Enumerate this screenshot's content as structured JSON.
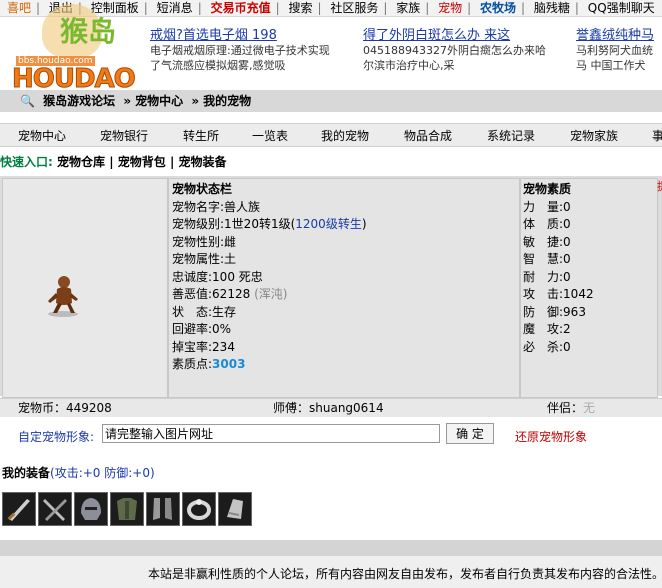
{
  "topnav": [
    "喜吧",
    "退出",
    "控制面板",
    "短消息",
    "交易币充值",
    "搜索",
    "社区服务",
    "家族",
    "宠物",
    "农牧场",
    "脑残糖",
    "QQ强制聊天"
  ],
  "logo": {
    "cn": "猴岛",
    "url": "bbs.houdao.com",
    "brand": "HOUDAO"
  },
  "ads": [
    {
      "title": "戒烟?首选电子烟 198",
      "desc1": "电子烟戒烟原理:通过微电子技术实现",
      "desc2": "了气流感应模拟烟雾,感觉吸"
    },
    {
      "title": "得了外阴白斑怎么办 来这",
      "desc1": "045188943327外阴白癍怎么办来哈",
      "desc2": "尔滨市治疗中心,采"
    },
    {
      "title": "誉鑫绒纯种马",
      "desc1": "马利努阿犬血统",
      "desc2": "马 中国工作犬"
    }
  ],
  "breadcrumb": [
    "猴岛游戏论坛",
    "宠物中心",
    "我的宠物"
  ],
  "menu": [
    "宠物中心",
    "宠物银行",
    "转生所",
    "一览表",
    "我的宠物",
    "物品合成",
    "系统记录",
    "宠物家族",
    "事"
  ],
  "quick": {
    "label": "快速入口:",
    "links": [
      "宠物仓库",
      "宠物背包",
      "宠物装备"
    ]
  },
  "status": {
    "title": "宠物状态栏",
    "name_label": "宠物名字:",
    "name": "兽人族",
    "level_label": "宠物级别:",
    "level": "1世20转1级(",
    "level_link": "1200级转生",
    "level_end": ")",
    "gender_label": "宠物性别:",
    "gender": "雌",
    "attr_label": "宠物属性:",
    "attr": "土",
    "loyalty_label": "忠诚度:",
    "loyalty": "100 死忠",
    "karma_label": "善恶值:",
    "karma": "62128",
    "karma_note": "(浑沌)",
    "state_label": "状　态:",
    "state": "生存",
    "evade_label": "回避率:",
    "evade": "0%",
    "drop_label": "掉宝率:",
    "drop": "234",
    "points_label": "素质点:",
    "points": "3003"
  },
  "quality": {
    "title": "宠物素质",
    "rows": [
      {
        "label": "力　量:",
        "value": "0"
      },
      {
        "label": "体　质:",
        "value": "0"
      },
      {
        "label": "敏　捷:",
        "value": "0"
      },
      {
        "label": "智　慧:",
        "value": "0"
      },
      {
        "label": "耐　力:",
        "value": "0"
      },
      {
        "label": "攻　击:",
        "value": "1042"
      },
      {
        "label": "防　御:",
        "value": "963"
      },
      {
        "label": "魔　攻:",
        "value": "2"
      },
      {
        "label": "必　杀:",
        "value": "0"
      }
    ]
  },
  "currency": {
    "coins": "宠物币：449208",
    "master": "师傅：shuang0614",
    "partner_label": "伴侣：",
    "partner": "无"
  },
  "custom": {
    "label": "自定宠物形象:",
    "value": "请完整输入图片网址",
    "confirm": "确 定",
    "restore": "还原宠物形象"
  },
  "equip": {
    "title": "我的装备",
    "stats": "(攻击:+0 防御:+0)"
  },
  "footer": "本站是非赢利性质的个人论坛，所有内容由网友自由发布，发布者自行负责其发布内容的合法性。"
}
